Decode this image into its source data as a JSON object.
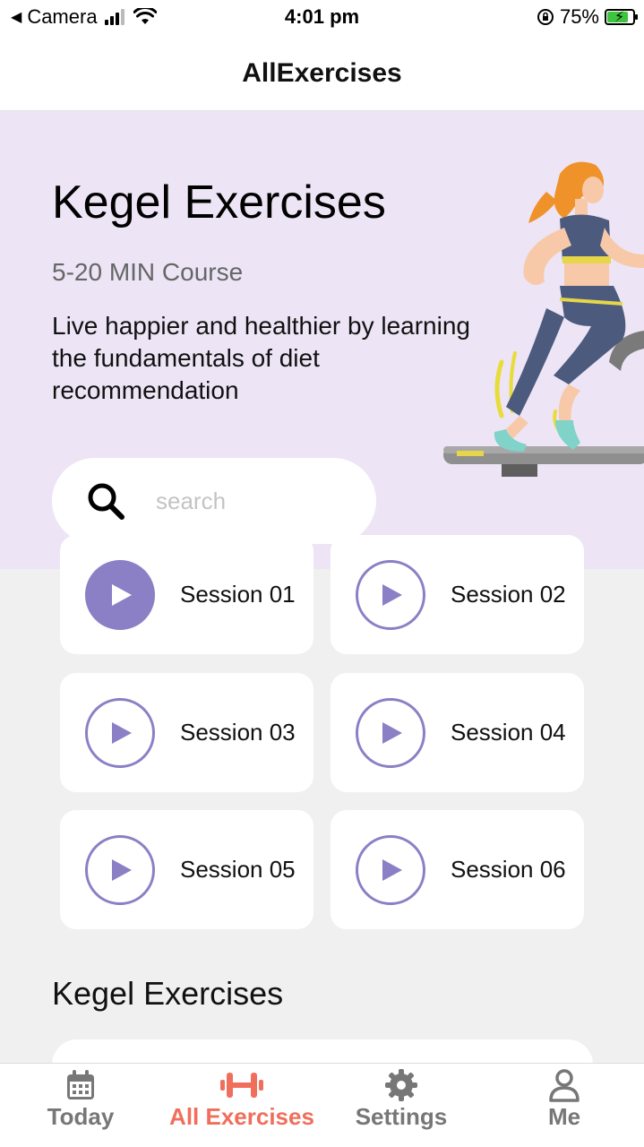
{
  "status_bar": {
    "back_app": "Camera",
    "time": "4:01 pm",
    "battery": "75%"
  },
  "header": {
    "title": "AllExercises"
  },
  "hero": {
    "title": "Kegel Exercises",
    "subtitle": "5-20 MIN Course",
    "description": "Live happier and healthier by learning the fundamentals of diet recommendation"
  },
  "search": {
    "placeholder": "search",
    "value": ""
  },
  "sessions": [
    {
      "label": "Session 01",
      "active": true
    },
    {
      "label": "Session 02",
      "active": false
    },
    {
      "label": "Session 03",
      "active": false
    },
    {
      "label": "Session 04",
      "active": false
    },
    {
      "label": "Session 05",
      "active": false
    },
    {
      "label": "Session 06",
      "active": false
    }
  ],
  "section": {
    "title": "Kegel Exercises"
  },
  "tabs": [
    {
      "label": "Today",
      "icon": "calendar-icon"
    },
    {
      "label": "All Exercises",
      "icon": "dumbbell-icon",
      "active": true
    },
    {
      "label": "Settings",
      "icon": "gear-icon"
    },
    {
      "label": "Me",
      "icon": "user-icon"
    }
  ],
  "colors": {
    "accent": "#8b7fc6",
    "hero_bg": "#ede4f5",
    "active_tab": "#f06f5c",
    "page_bg": "#f0f0f0"
  }
}
